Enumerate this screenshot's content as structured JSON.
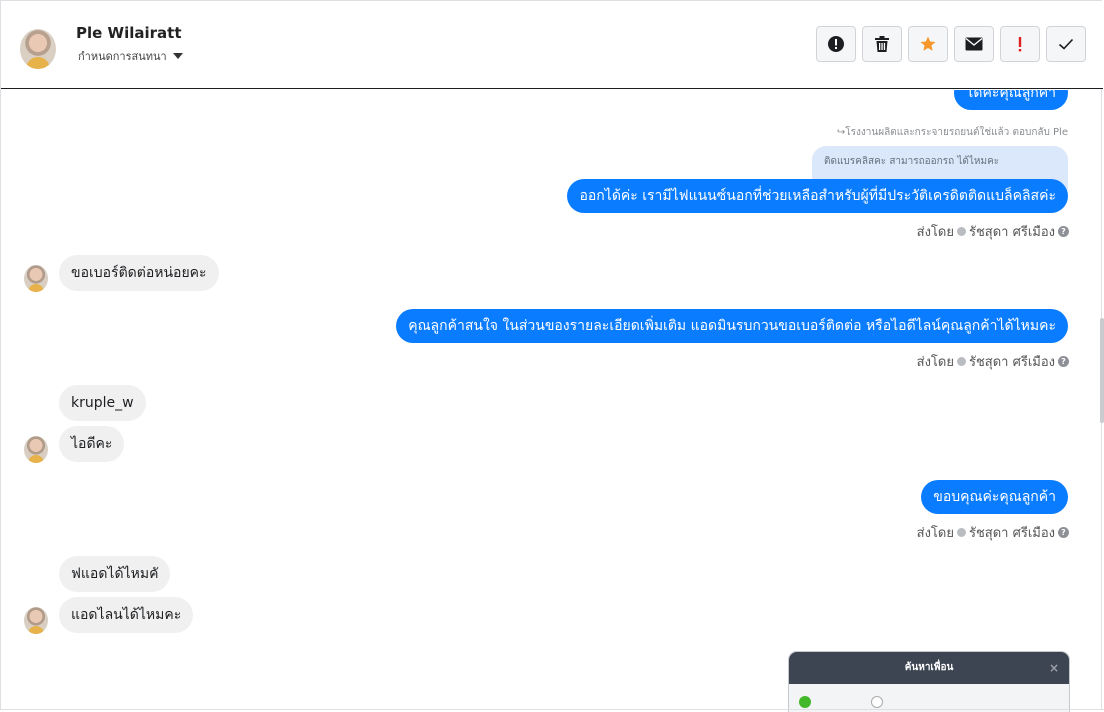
{
  "header": {
    "contact_name": "Ple Wilairatt",
    "assign_label": "กำหนดการสนทนา",
    "tools": [
      {
        "name": "report-icon",
        "color": "#1c1e21"
      },
      {
        "name": "trash-icon",
        "color": "#1c1e21"
      },
      {
        "name": "star-icon",
        "color": "#f5962a"
      },
      {
        "name": "envelope-icon",
        "color": "#1c1e21"
      },
      {
        "name": "important-icon",
        "color": "#e02020"
      },
      {
        "name": "check-icon",
        "color": "#1c1e21"
      }
    ]
  },
  "conversation": {
    "partial_top_message": "โดคะคุณลูกคา",
    "reply_note": "↪โรงงานผลิตและกระจายรถยนต์ใช่แล้ว ตอบกลับ Ple",
    "quoted_message": "ติดแบรคลิสคะ สามารถออกรถ ได้ไหมคะ",
    "messages": [
      {
        "direction": "out",
        "text": "ออกได้ค่ะ เรามีไฟแนนซ์นอกที่ช่วยเหลือสำหรับผู้ที่มีประวัติเครดิตติดแบล็คลิสค่ะ"
      },
      {
        "direction": "in",
        "text": "ขอเบอร์ติดต่อหน่อยคะ"
      },
      {
        "direction": "out",
        "text": "คุณลูกค้าสนใจ ในส่วนของรายละเอียดเพิ่มเติม แอดมินรบกวนขอเบอร์ติดต่อ หรือไอดีไลน์คุณลูกค้าได้ไหมคะ"
      },
      {
        "direction": "in",
        "text": "kruple_w"
      },
      {
        "direction": "in",
        "text": "ไอดีคะ"
      },
      {
        "direction": "out",
        "text": "ขอบคุณค่ะคุณลูกค้า"
      },
      {
        "direction": "in",
        "text": "ฟแอดได้ไหมคั"
      },
      {
        "direction": "in",
        "text": "แอดไลนได้ไหมคะ"
      }
    ],
    "sent_by_label": "ส่งโดย",
    "sender_name": "รัชสุดา ศรีเมือง",
    "colors": {
      "outgoing": "#0a7cff",
      "incoming": "#f0f0f0"
    }
  },
  "popup": {
    "title": "ค้นหาเพื่อน",
    "close": "×"
  }
}
